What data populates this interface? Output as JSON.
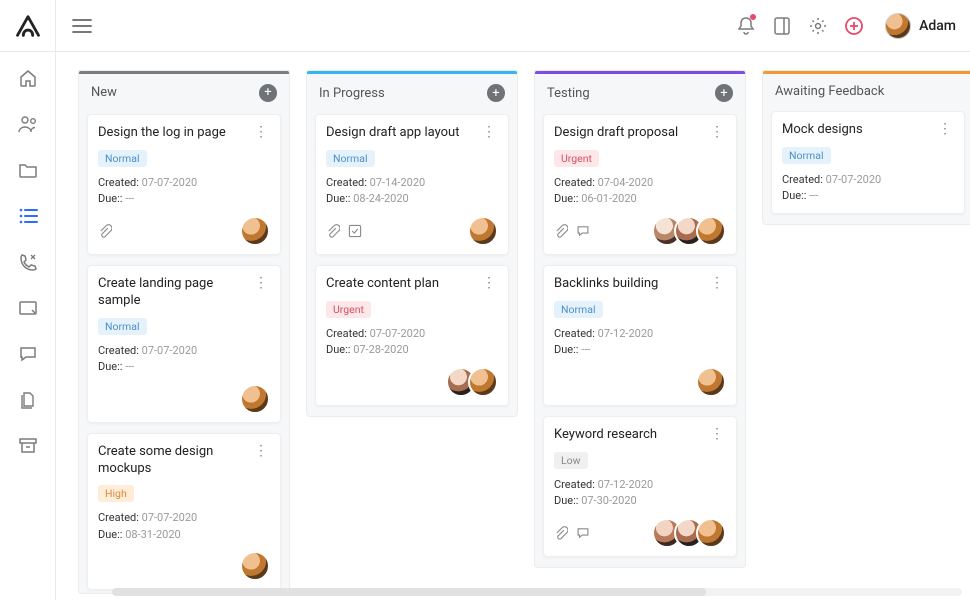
{
  "user": {
    "name": "Adam"
  },
  "meta_labels": {
    "created": "Created:",
    "due": "Due::"
  },
  "columns": [
    {
      "id": "new",
      "title": "New",
      "accent": "#7a7d82",
      "has_add": true,
      "cards": [
        {
          "title": "Design the log in page",
          "priority": "Normal",
          "priority_class": "normal",
          "created": "07-07-2020",
          "due": "---",
          "icons": [
            "attach"
          ],
          "avatars": [
            "v1"
          ]
        },
        {
          "title": "Create landing page sample",
          "priority": "Normal",
          "priority_class": "normal",
          "created": "07-07-2020",
          "due": "---",
          "icons": [],
          "avatars": [
            "v1"
          ]
        },
        {
          "title": "Create some design mockups",
          "priority": "High",
          "priority_class": "high",
          "created": "07-07-2020",
          "due": "08-31-2020",
          "icons": [],
          "avatars": [
            "v1"
          ]
        }
      ]
    },
    {
      "id": "inprogress",
      "title": "In Progress",
      "accent": "#35b6f4",
      "has_add": true,
      "cards": [
        {
          "title": "Design draft app layout",
          "priority": "Normal",
          "priority_class": "normal",
          "created": "07-14-2020",
          "due": "08-24-2020",
          "icons": [
            "attach",
            "check"
          ],
          "avatars": [
            "v1"
          ]
        },
        {
          "title": "Create content plan",
          "priority": "Urgent",
          "priority_class": "urgent",
          "created": "07-07-2020",
          "due": "07-28-2020",
          "icons": [],
          "avatars": [
            "v3",
            "v1"
          ]
        }
      ]
    },
    {
      "id": "testing",
      "title": "Testing",
      "accent": "#7a4de8",
      "has_add": true,
      "cards": [
        {
          "title": "Design draft proposal",
          "priority": "Urgent",
          "priority_class": "urgent",
          "created": "07-04-2020",
          "due": "06-01-2020",
          "icons": [
            "attach",
            "comment"
          ],
          "avatars": [
            "v4",
            "v3",
            "v1"
          ]
        },
        {
          "title": "Backlinks building",
          "priority": "Normal",
          "priority_class": "normal",
          "created": "07-12-2020",
          "due": "---",
          "icons": [],
          "avatars": [
            "v1"
          ]
        },
        {
          "title": "Keyword research",
          "priority": "Low",
          "priority_class": "low",
          "created": "07-12-2020",
          "due": "07-30-2020",
          "icons": [
            "attach",
            "comment"
          ],
          "avatars": [
            "v2",
            "v3",
            "v1"
          ]
        }
      ]
    },
    {
      "id": "awaiting",
      "title": "Awaiting Feedback",
      "accent": "#f29a2e",
      "has_add": false,
      "cards": [
        {
          "title": "Mock designs",
          "priority": "Normal",
          "priority_class": "normal",
          "created": "07-07-2020",
          "due": "---",
          "icons": [],
          "avatars": []
        }
      ]
    }
  ]
}
